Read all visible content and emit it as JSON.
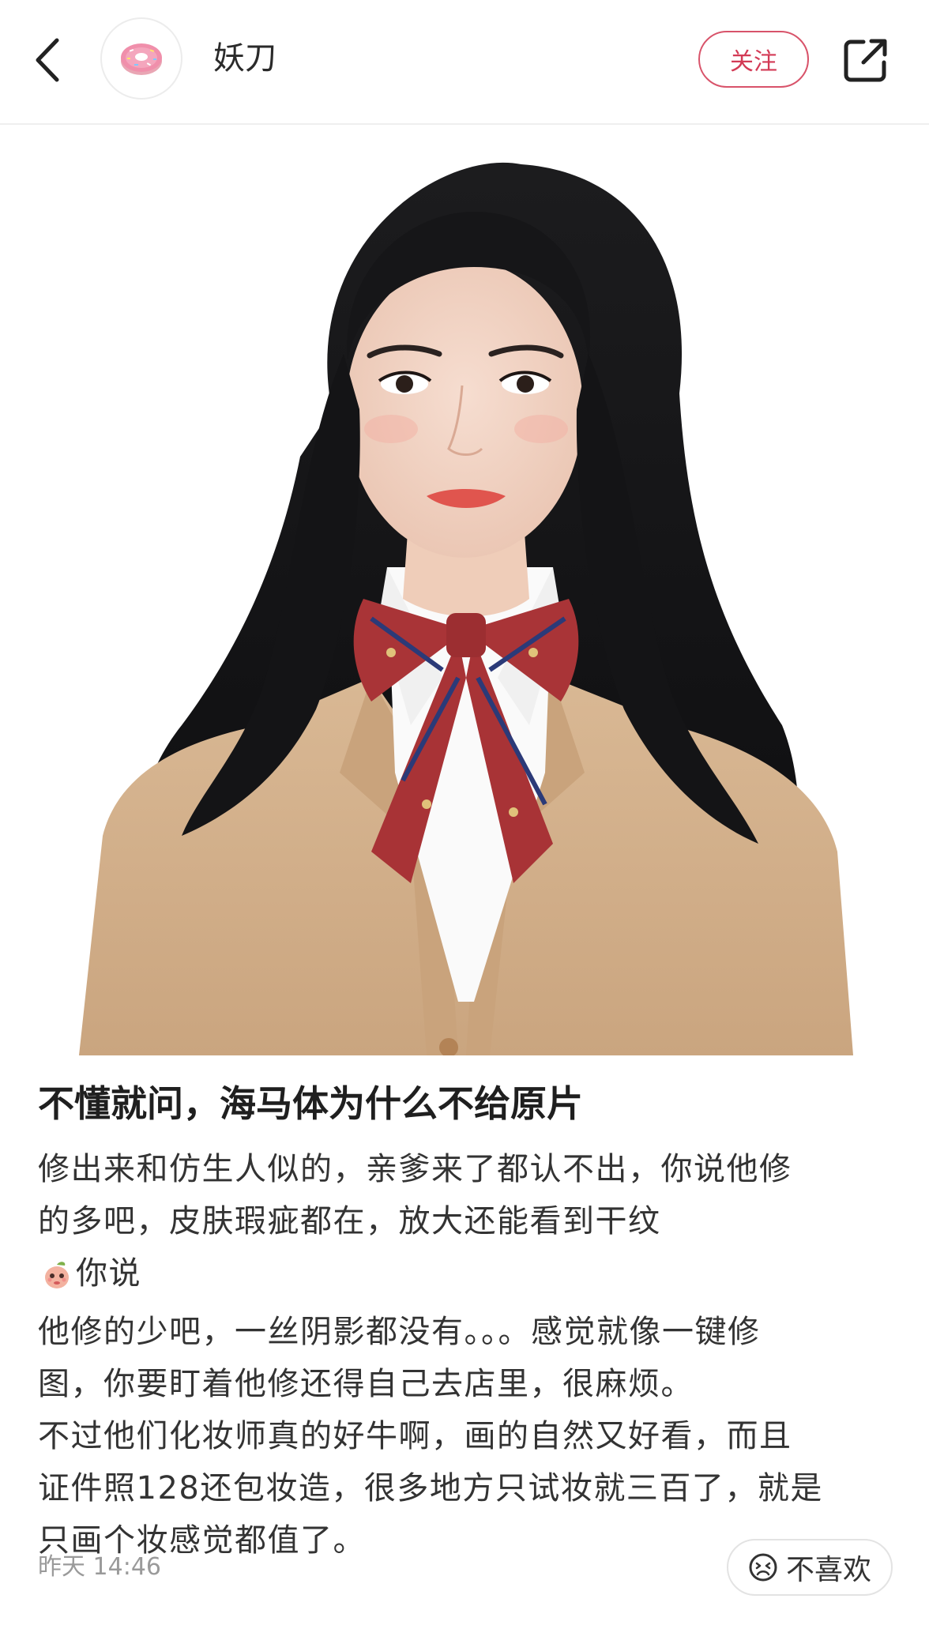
{
  "header": {
    "back_icon": "chevron-left-icon",
    "avatar_icon": "donut-avatar",
    "username": "妖刀",
    "follow_label": "关注",
    "share_icon": "share-external-icon"
  },
  "post": {
    "image_description_icon": "portrait-photo",
    "title": "不懂就问，海马体为什么不给原片",
    "body_lines": [
      "修出来和仿生人似的，亲爹来了都认不出，你说他修",
      "的多吧，皮肤瑕疵都在，放大还能看到干纹",
      "你说",
      "他修的少吧，一丝阴影都没有。。。感觉就像一键修",
      "图，你要盯着他修还得自己去店里，很麻烦。",
      "不过他们化妆师真的好牛啊，画的自然又好看，而且",
      "证件照128还包妆造，很多地方只试妆就三百了，就是",
      "只画个妆感觉都值了。"
    ],
    "inline_emoji": "peach-emoji",
    "timestamp": "昨天 14:46",
    "dislike_label": "不喜欢",
    "dislike_icon": "unhappy-face-icon"
  },
  "colors": {
    "accent": "#d33a55",
    "muted_text": "#9a9a9a",
    "body_text": "#333333"
  }
}
